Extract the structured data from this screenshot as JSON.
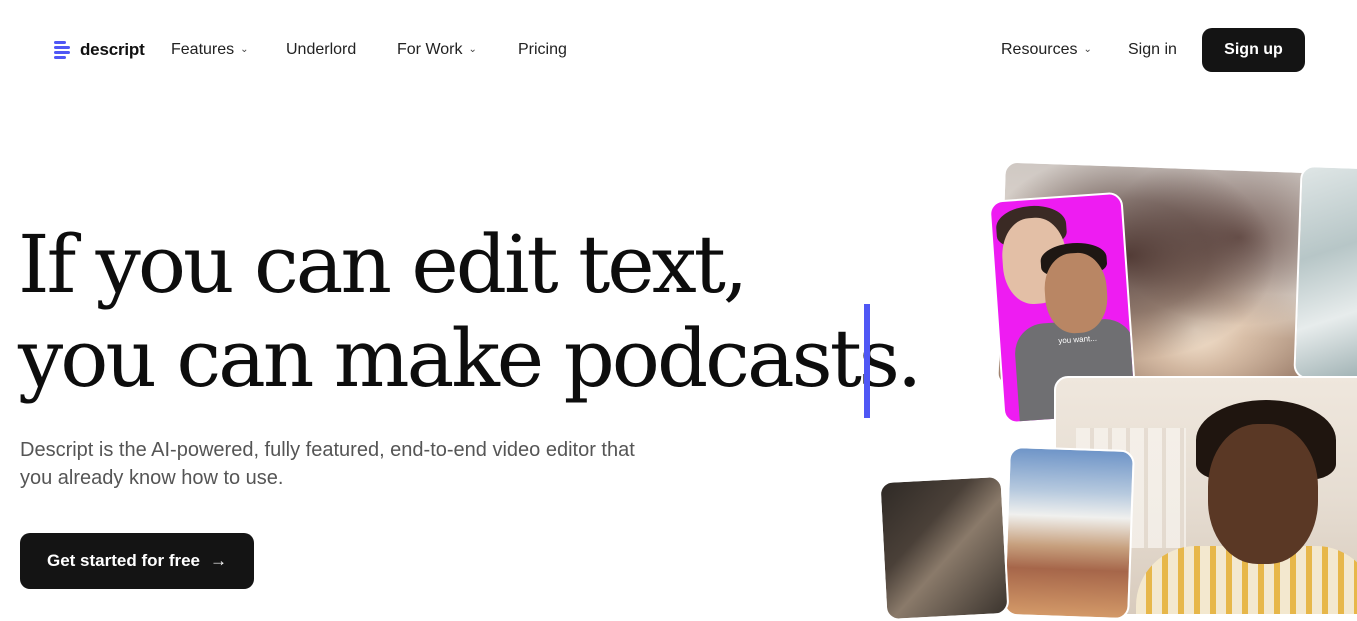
{
  "brand": {
    "name": "descript",
    "accent": "#4f57f5"
  },
  "nav": {
    "items": [
      {
        "label": "Features",
        "has_dropdown": true
      },
      {
        "label": "Underlord",
        "has_dropdown": false
      },
      {
        "label": "For Work",
        "has_dropdown": true
      },
      {
        "label": "Pricing",
        "has_dropdown": false
      }
    ],
    "right": {
      "resources": {
        "label": "Resources",
        "has_dropdown": true
      },
      "sign_in": "Sign in",
      "sign_up": "Sign up"
    }
  },
  "hero": {
    "headline_line1": "If you can edit text,",
    "headline_line2": "you can make podcasts.",
    "subtitle": "Descript is the AI-powered, fully featured, end-to-end video editor that you already know how to use.",
    "cta_label": "Get started for free",
    "cta_icon": "arrow-right-icon"
  },
  "collage": {
    "video_caption": "you want..."
  }
}
